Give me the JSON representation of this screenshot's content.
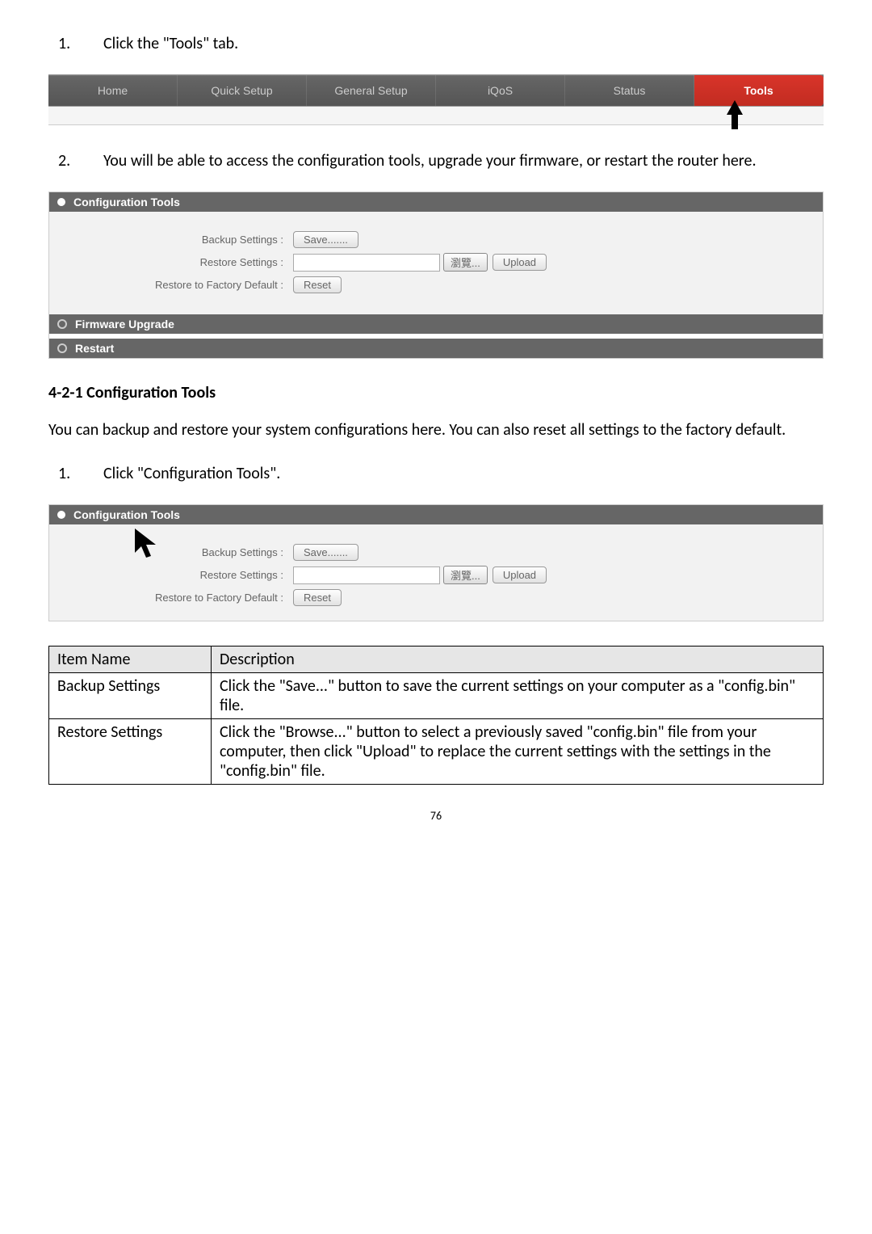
{
  "step1_num": "1.",
  "step1_text": "Click the \"Tools\" tab.",
  "navbar": {
    "tabs": [
      "Home",
      "Quick Setup",
      "General Setup",
      "iQoS",
      "Status",
      "Tools"
    ]
  },
  "step2_num": "2.",
  "step2_text": "You will be able to access the configuration tools, upgrade your firmware, or restart the router here.",
  "panel1": {
    "header_config": "Configuration Tools",
    "backup_label": "Backup Settings :",
    "save_btn": "Save.......",
    "restore_label": "Restore Settings :",
    "browse_btn": "瀏覽...",
    "upload_btn": "Upload",
    "factory_label": "Restore to Factory Default :",
    "reset_btn": "Reset",
    "header_firmware": "Firmware Upgrade",
    "header_restart": "Restart"
  },
  "section_title": "4-2-1 Configuration Tools",
  "body_text": "You can backup and restore your system configurations here. You can also reset all settings to the factory default.",
  "step3_num": "1.",
  "step3_text": "Click \"Configuration Tools\".",
  "table": {
    "header_item": "Item Name",
    "header_desc": "Description",
    "rows": [
      {
        "item": "Backup Settings",
        "desc": "Click the \"Save...\" button to save the current settings on your computer as a \"config.bin\" file."
      },
      {
        "item": "Restore Settings",
        "desc": "Click the \"Browse...\" button to select a previously saved \"config.bin\" file from your computer, then click \"Upload\" to replace the current settings with the settings in the \"config.bin\" file."
      }
    ]
  },
  "page_number": "76"
}
